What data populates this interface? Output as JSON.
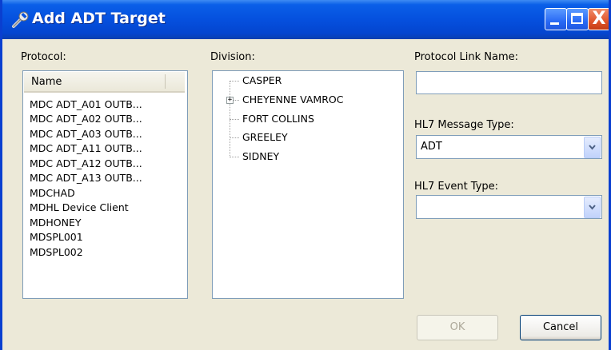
{
  "window": {
    "title": "Add ADT Target",
    "icon": "wrench-icon",
    "controls": [
      "minimize-icon",
      "maximize-icon",
      "close-icon"
    ],
    "close_glyph": "X"
  },
  "protocol": {
    "label": "Protocol:",
    "column_header": "Name",
    "items": [
      "MDC ADT_A01 OUTB...",
      "MDC ADT_A02 OUTB...",
      "MDC ADT_A03 OUTB...",
      "MDC ADT_A11 OUTB...",
      "MDC ADT_A12 OUTB...",
      "MDC ADT_A13 OUTB...",
      "MDCHAD",
      "MDHL Device Client",
      "MDHONEY",
      "MDSPL001",
      "MDSPL002"
    ]
  },
  "division": {
    "label": "Division:",
    "items": [
      {
        "label": "CASPER",
        "expandable": false
      },
      {
        "label": "CHEYENNE VAMROC",
        "expandable": true,
        "expander": "+"
      },
      {
        "label": "FORT COLLINS",
        "expandable": false
      },
      {
        "label": "GREELEY",
        "expandable": false
      },
      {
        "label": "SIDNEY",
        "expandable": false
      }
    ]
  },
  "protocol_link_name": {
    "label": "Protocol Link Name:",
    "value": ""
  },
  "hl7_message_type": {
    "label": "HL7 Message Type:",
    "value": "ADT"
  },
  "hl7_event_type": {
    "label": "HL7 Event Type:",
    "value": ""
  },
  "buttons": {
    "ok": "OK",
    "cancel": "Cancel",
    "ok_enabled": false
  },
  "colors": {
    "titlebar": "#0550de",
    "dialog_bg": "#ece9d8",
    "border": "#7f9db9"
  }
}
